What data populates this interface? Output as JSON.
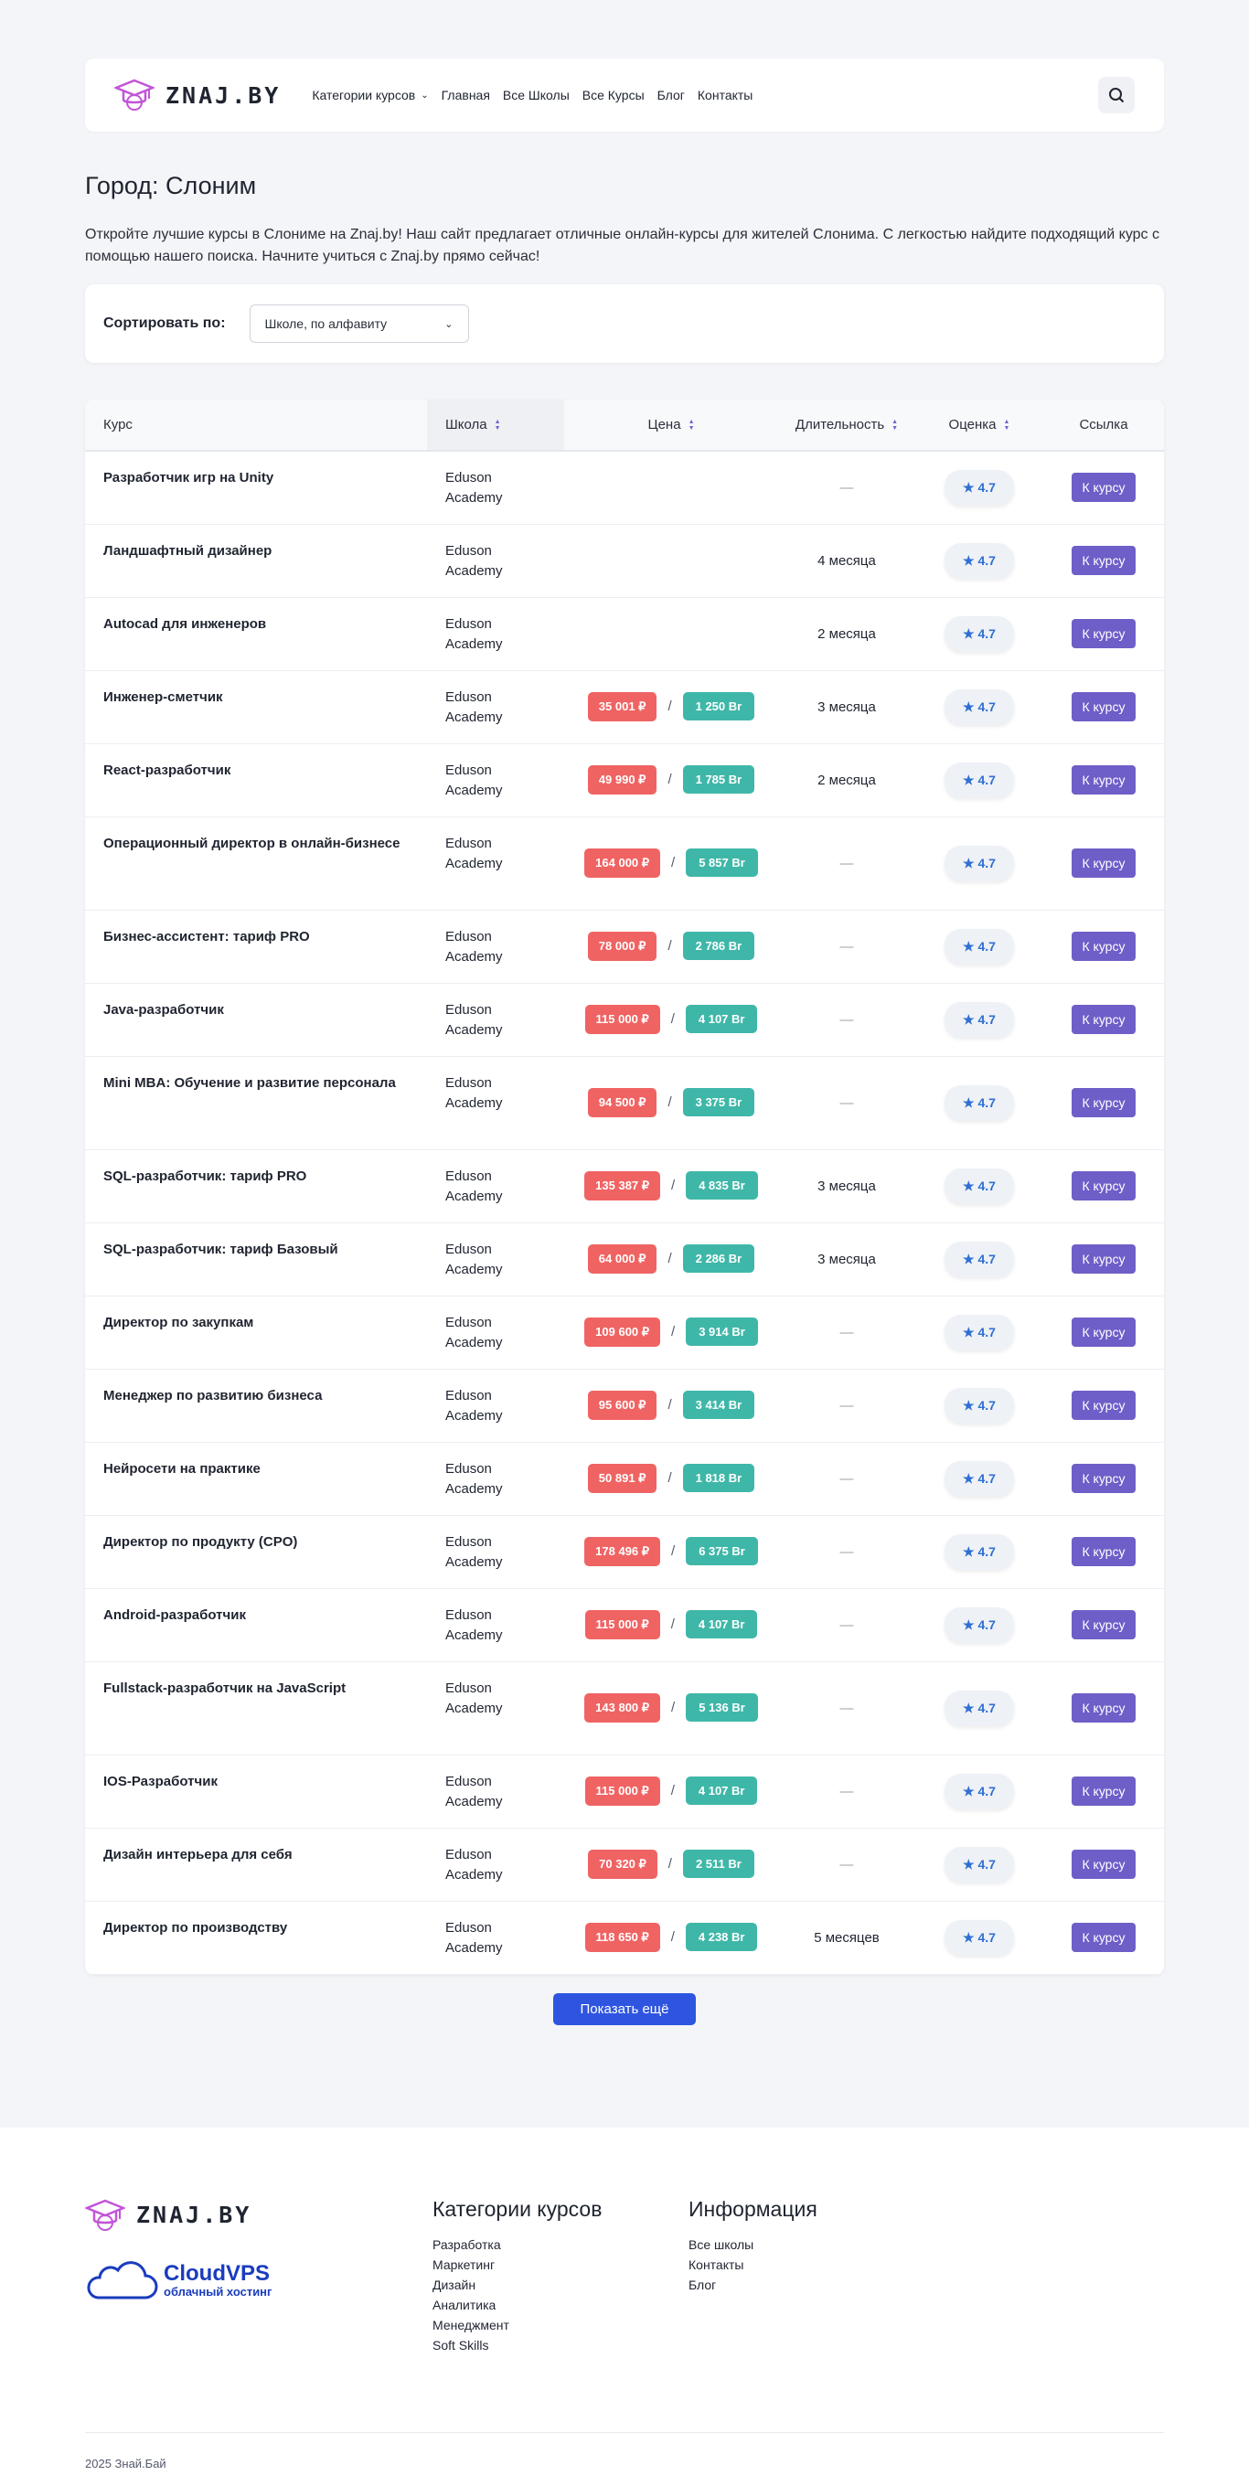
{
  "brand": {
    "name": "ZNAJ.BY"
  },
  "nav": {
    "items": [
      {
        "label": "Категории курсов",
        "dropdown": true
      },
      {
        "label": "Главная"
      },
      {
        "label": "Все Школы"
      },
      {
        "label": "Все Курсы"
      },
      {
        "label": "Блог"
      },
      {
        "label": "Контакты"
      }
    ]
  },
  "page": {
    "title": "Город: Слоним",
    "intro": "Откройте лучшие курсы в Слониме на Znaj.by! Наш сайт предлагает отличные онлайн-курсы для жителей Слонима. С легкостью найдите подходящий курс с помощью нашего поиска. Начните учиться с Znaj.by прямо сейчас!"
  },
  "sort": {
    "label": "Сортировать по:",
    "value": "Школе, по алфавиту"
  },
  "table": {
    "headers": {
      "course": "Курс",
      "school": "Школа",
      "price": "Цена",
      "duration": "Длительность",
      "rating": "Оценка",
      "link": "Ссылка"
    },
    "rows": [
      {
        "course": "Разработчик игр на Unity",
        "school": "Eduson Academy",
        "rub": "",
        "byn": "",
        "duration": "—",
        "rating": "★ 4.7",
        "link": "К курсу"
      },
      {
        "course": "Ландшафтный дизайнер",
        "school": "Eduson Academy",
        "rub": "",
        "byn": "",
        "duration": "4 месяца",
        "rating": "★ 4.7",
        "link": "К курсу"
      },
      {
        "course": "Autocad для инженеров",
        "school": "Eduson Academy",
        "rub": "",
        "byn": "",
        "duration": "2 месяца",
        "rating": "★ 4.7",
        "link": "К курсу"
      },
      {
        "course": "Инженер-сметчик",
        "school": "Eduson Academy",
        "rub": "35 001 ₽",
        "byn": "1 250 Br",
        "duration": "3 месяца",
        "rating": "★ 4.7",
        "link": "К курсу"
      },
      {
        "course": "React-разработчик",
        "school": "Eduson Academy",
        "rub": "49 990 ₽",
        "byn": "1 785 Br",
        "duration": "2 месяца",
        "rating": "★ 4.7",
        "link": "К курсу"
      },
      {
        "course": "Операционный директор в онлайн-бизнесе",
        "school": "Eduson Academy",
        "rub": "164 000 ₽",
        "byn": "5 857 Br",
        "duration": "—",
        "rating": "★ 4.7",
        "link": "К курсу"
      },
      {
        "course": "Бизнес-ассистент: тариф PRO",
        "school": "Eduson Academy",
        "rub": "78 000 ₽",
        "byn": "2 786 Br",
        "duration": "—",
        "rating": "★ 4.7",
        "link": "К курсу"
      },
      {
        "course": "Java-разработчик",
        "school": "Eduson Academy",
        "rub": "115 000 ₽",
        "byn": "4 107 Br",
        "duration": "—",
        "rating": "★ 4.7",
        "link": "К курсу"
      },
      {
        "course": "Mini MBA: Обучение и развитие персонала",
        "school": "Eduson Academy",
        "rub": "94 500 ₽",
        "byn": "3 375 Br",
        "duration": "—",
        "rating": "★ 4.7",
        "link": "К курсу"
      },
      {
        "course": "SQL-разработчик: тариф PRO",
        "school": "Eduson Academy",
        "rub": "135 387 ₽",
        "byn": "4 835 Br",
        "duration": "3 месяца",
        "rating": "★ 4.7",
        "link": "К курсу"
      },
      {
        "course": "SQL-разработчик: тариф Базовый",
        "school": "Eduson Academy",
        "rub": "64 000 ₽",
        "byn": "2 286 Br",
        "duration": "3 месяца",
        "rating": "★ 4.7",
        "link": "К курсу"
      },
      {
        "course": "Директор по закупкам",
        "school": "Eduson Academy",
        "rub": "109 600 ₽",
        "byn": "3 914 Br",
        "duration": "—",
        "rating": "★ 4.7",
        "link": "К курсу"
      },
      {
        "course": "Менеджер по развитию бизнеса",
        "school": "Eduson Academy",
        "rub": "95 600 ₽",
        "byn": "3 414 Br",
        "duration": "—",
        "rating": "★ 4.7",
        "link": "К курсу"
      },
      {
        "course": "Нейросети на практике",
        "school": "Eduson Academy",
        "rub": "50 891 ₽",
        "byn": "1 818 Br",
        "duration": "—",
        "rating": "★ 4.7",
        "link": "К курсу"
      },
      {
        "course": "Директор по продукту (CPO)",
        "school": "Eduson Academy",
        "rub": "178 496 ₽",
        "byn": "6 375 Br",
        "duration": "—",
        "rating": "★ 4.7",
        "link": "К курсу"
      },
      {
        "course": "Android-разработчик",
        "school": "Eduson Academy",
        "rub": "115 000 ₽",
        "byn": "4 107 Br",
        "duration": "—",
        "rating": "★ 4.7",
        "link": "К курсу"
      },
      {
        "course": "Fullstack-разработчик на JavaScript",
        "school": "Eduson Academy",
        "rub": "143 800 ₽",
        "byn": "5 136 Br",
        "duration": "—",
        "rating": "★ 4.7",
        "link": "К курсу"
      },
      {
        "course": "IOS-Разработчик",
        "school": "Eduson Academy",
        "rub": "115 000 ₽",
        "byn": "4 107 Br",
        "duration": "—",
        "rating": "★ 4.7",
        "link": "К курсу"
      },
      {
        "course": "Дизайн интерьера для себя",
        "school": "Eduson Academy",
        "rub": "70 320 ₽",
        "byn": "2 511 Br",
        "duration": "—",
        "rating": "★ 4.7",
        "link": "К курсу"
      },
      {
        "course": "Директор по производству",
        "school": "Eduson Academy",
        "rub": "118 650 ₽",
        "byn": "4 238 Br",
        "duration": "5 месяцев",
        "rating": "★ 4.7",
        "link": "К курсу"
      }
    ],
    "price_separator": "/"
  },
  "more_button": "Показать ещё",
  "footer": {
    "sponsor": {
      "name": "CloudVPS",
      "tagline": "облачный хостинг"
    },
    "categories": {
      "title": "Категории курсов",
      "items": [
        "Разработка",
        "Маркетинг",
        "Дизайн",
        "Аналитика",
        "Менеджмент",
        "Soft Skills"
      ]
    },
    "info": {
      "title": "Информация",
      "items": [
        "Все школы",
        "Контакты",
        "Блог"
      ]
    },
    "copyright": "2025 Знай.Бай"
  },
  "colors": {
    "price_rub": "#f06363",
    "price_byn": "#3fb7a8",
    "course_button": "#6e5ec8",
    "more_button": "#2f55e0",
    "rating_text": "#2e6fd3"
  }
}
